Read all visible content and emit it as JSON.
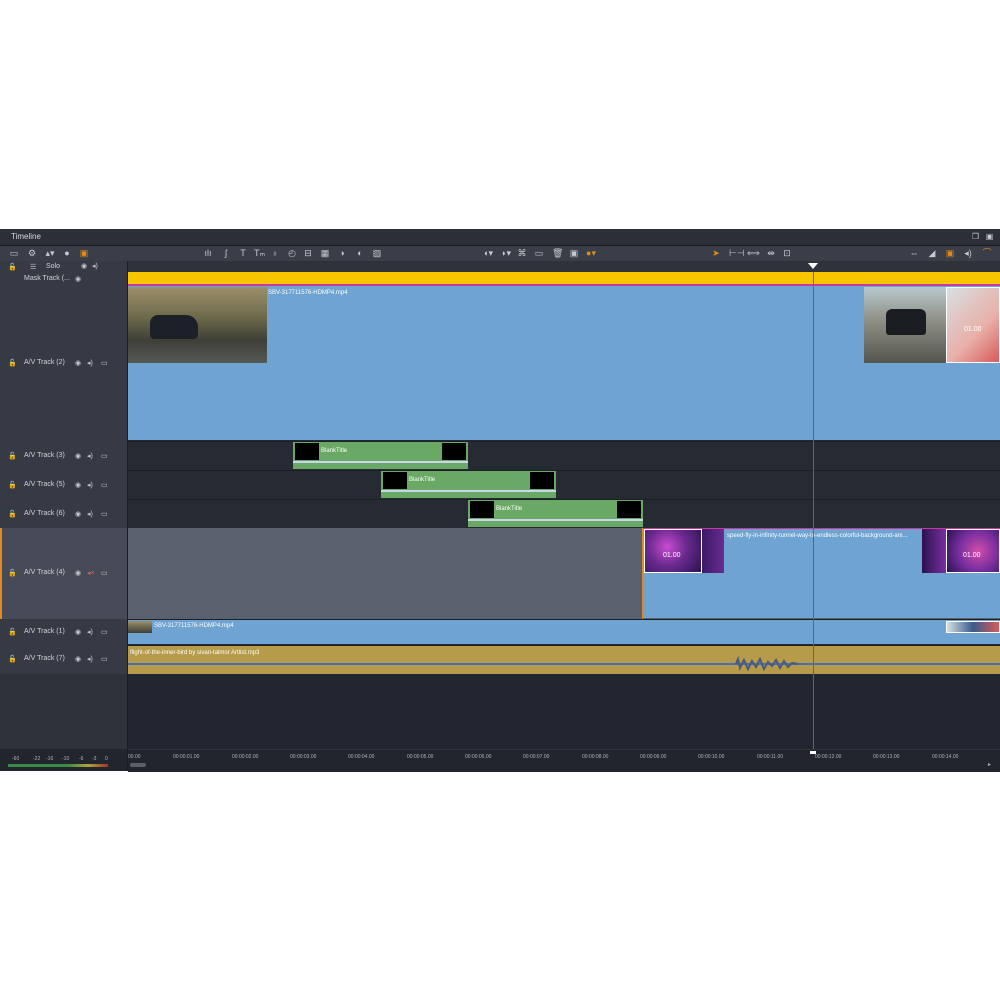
{
  "window": {
    "title": "Timeline"
  },
  "header": {
    "solo_label": "Solo",
    "tracks": [
      {
        "name": "Mask Track (..."
      },
      {
        "name": "A/V Track (2)"
      },
      {
        "name": "A/V Track (3)"
      },
      {
        "name": "A/V Track (5)"
      },
      {
        "name": "A/V Track (6)"
      },
      {
        "name": "A/V Track (4)"
      },
      {
        "name": "A/V Track (1)"
      },
      {
        "name": "A/V Track (7)"
      }
    ]
  },
  "clips": {
    "av2_clip": "SBV-317711576-HDMP4.mp4",
    "av2_transition_value": "01.00",
    "av3_title": "BlankTitle",
    "av5_title": "BlankTitle",
    "av6_title": "BlankTitle",
    "av4_transition_left": "01.00",
    "av4_clip": "speed-fly-in-infinity-tunnel-way-to-endless-colorful-background-ani...",
    "av4_transition_right": "01.00",
    "av1_clip": "SBV-317711576-HDMP4.mp4",
    "av7_audio": "flight-of-the-inner-bird by sivan-talmor Artlist.mp3"
  },
  "ruler": {
    "ticks": [
      "00.00",
      "00:00:01.00",
      "00:00:02.00",
      "00:00:03.00",
      "00:00:04.00",
      "00:00:05.00",
      "00:00:06.00",
      "00:00:07.00",
      "00:00:08.00",
      "00:00:09.00",
      "00:00:10.00",
      "00:00:11.00",
      "00:00:12.00",
      "00:00:13.00",
      "00:00:14.00"
    ]
  },
  "meters": {
    "labels": [
      "-60",
      "-22",
      "-16",
      "-10",
      "-6",
      "-3",
      "0"
    ]
  },
  "colors": {
    "video_clip": "#6fa3d2",
    "title_clip": "#6aa865",
    "audio_clip": "#b59b4a",
    "mask_bar": "#f7c600",
    "playhead": "#e0302a",
    "accent": "#e28a1c"
  },
  "icons": {
    "toolbar_left": [
      "storyboard-icon",
      "settings-icon",
      "audio-mixer-icon",
      "record-icon",
      "snapshot-icon"
    ],
    "toolbar_mid": [
      "levels-icon",
      "speed-icon",
      "title-icon",
      "text-icon",
      "microphone-icon",
      "clock-icon",
      "split-icon",
      "grid-icon",
      "blend-icon",
      "overlay-icon",
      "image-icon"
    ],
    "toolbar_right": [
      "marker-icon",
      "marker-options-icon",
      "link-icon",
      "keyframe-icon",
      "delete-icon",
      "capture-icon",
      "pin-icon"
    ],
    "toolbar_far_right": [
      "pointer-icon",
      "trim-icon",
      "slip-icon",
      "slide-icon",
      "fit-icon",
      "volume-split-icon",
      "mute-icon",
      "audio-icon",
      "wave-icon",
      "speaker-icon"
    ]
  }
}
